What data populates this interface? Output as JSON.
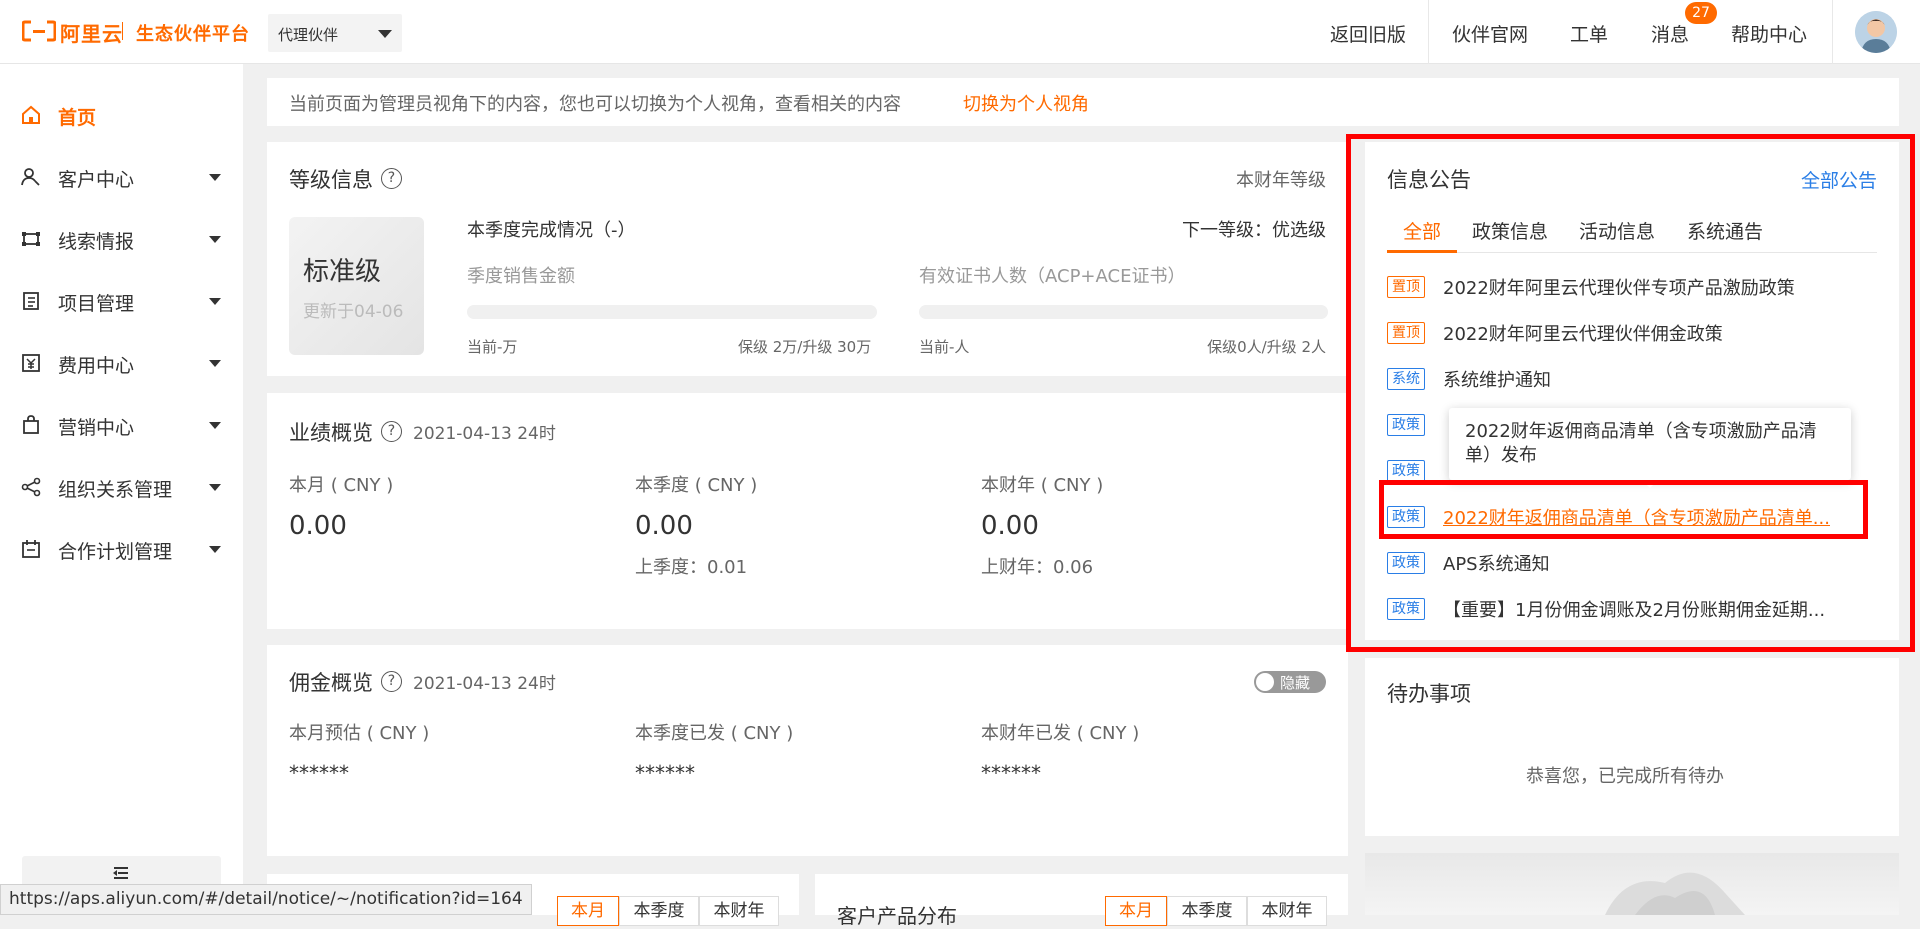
{
  "header": {
    "logo_text": "阿里云",
    "platform_name": "生态伙伴平台",
    "role_select": "代理伙伴",
    "nav": [
      "返回旧版",
      "伙伴官网",
      "工单",
      "消息",
      "帮助中心"
    ],
    "message_count": "27"
  },
  "sidebar": {
    "items": [
      {
        "label": "首页",
        "icon": "home-icon"
      },
      {
        "label": "客户中心",
        "icon": "customer-icon"
      },
      {
        "label": "线索情报",
        "icon": "leads-icon"
      },
      {
        "label": "项目管理",
        "icon": "project-icon"
      },
      {
        "label": "费用中心",
        "icon": "yen-icon"
      },
      {
        "label": "营销中心",
        "icon": "bag-icon"
      },
      {
        "label": "组织关系管理",
        "icon": "share-icon"
      },
      {
        "label": "合作计划管理",
        "icon": "calendar-icon"
      }
    ],
    "collapse_icon": "collapse-icon"
  },
  "banner": {
    "text": "当前页面为管理员视角下的内容，您也可以切换为个人视角，查看相关的内容",
    "link": "切换为个人视角"
  },
  "level": {
    "title": "等级信息",
    "fiscal_label": "本财年等级",
    "level_name": "标准级",
    "updated": "更新于04-06",
    "quarter_status": "本季度完成情况（-）",
    "next_level": "下一等级：优选级",
    "sales_label": "季度销售金额",
    "cert_label": "有效证书人数（ACP+ACE证书）",
    "sales_current": "当前-万",
    "sales_target": "保级 2万/升级 30万",
    "cert_current": "当前-人",
    "cert_target": "保级0人/升级 2人"
  },
  "performance": {
    "title": "业绩概览",
    "date": "2021-04-13 24时",
    "cols": [
      {
        "label": "本月 ( CNY )",
        "value": "0.00",
        "sub": ""
      },
      {
        "label": "本季度 ( CNY )",
        "value": "0.00",
        "sub": "上季度：0.01"
      },
      {
        "label": "本财年 ( CNY )",
        "value": "0.00",
        "sub": "上财年：0.06"
      }
    ]
  },
  "commission": {
    "title": "佣金概览",
    "date": "2021-04-13 24时",
    "toggle_label": "隐藏",
    "cols": [
      {
        "label": "本月预估 ( CNY )",
        "value": "******"
      },
      {
        "label": "本季度已发 ( CNY )",
        "value": "******"
      },
      {
        "label": "本财年已发 ( CNY )",
        "value": "******"
      }
    ]
  },
  "bottom_left": {
    "tabs": [
      "本月",
      "本季度",
      "本财年"
    ]
  },
  "bottom_right": {
    "title": "客户产品分布",
    "tabs": [
      "本月",
      "本季度",
      "本财年"
    ]
  },
  "notices": {
    "title": "信息公告",
    "all_link": "全部公告",
    "tabs": [
      "全部",
      "政策信息",
      "活动信息",
      "系统通告"
    ],
    "items": [
      {
        "tag": "置顶",
        "text": "2022财年阿里云代理伙伴专项产品激励政策"
      },
      {
        "tag": "置顶",
        "text": "2022财年阿里云代理伙伴佣金政策"
      },
      {
        "tag": "系统",
        "text": "系统维护通知"
      },
      {
        "tag": "政策",
        "text": ""
      },
      {
        "tag": "政策",
        "text": ""
      },
      {
        "tag": "政策",
        "text": "2022财年返佣商品清单（含专项激励产品清单..."
      },
      {
        "tag": "政策",
        "text": "APS系统通知"
      },
      {
        "tag": "政策",
        "text": "【重要】1月份佣金调账及2月份账期佣金延期..."
      }
    ],
    "tooltip": "2022财年返佣商品清单（含专项激励产品清单）发布"
  },
  "todo": {
    "title": "待办事项",
    "empty": "恭喜您，已完成所有待办"
  },
  "status_bar": {
    "url": "https://aps.aliyun.com/#/detail/notice/~/notification?id=164"
  },
  "colors": {
    "brand": "#ff6a00",
    "link": "#2a7ee6",
    "highlight": "#ff0000"
  }
}
